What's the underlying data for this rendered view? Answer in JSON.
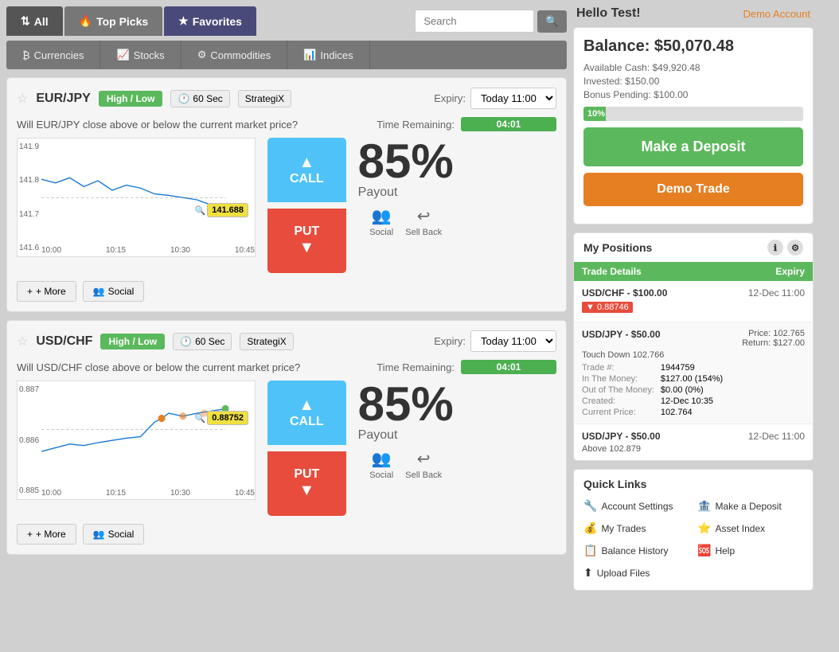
{
  "header": {
    "tabs": [
      {
        "id": "all",
        "label": "All",
        "icon": "⇅",
        "active": true
      },
      {
        "id": "top-picks",
        "label": "Top Picks",
        "icon": "★",
        "active": false
      },
      {
        "id": "favorites",
        "label": "Favorites",
        "icon": "★",
        "active": false
      }
    ],
    "search_placeholder": "Search"
  },
  "subnav": [
    {
      "id": "currencies",
      "label": "Currencies",
      "icon": "₿"
    },
    {
      "id": "stocks",
      "label": "Stocks",
      "icon": "📈"
    },
    {
      "id": "commodities",
      "label": "Commodities",
      "icon": "⚙"
    },
    {
      "id": "indices",
      "label": "Indices",
      "icon": "📊"
    }
  ],
  "trades": [
    {
      "id": "eurjpy",
      "asset": "EUR/JPY",
      "badge": "High / Low",
      "duration": "60 Sec",
      "strategy": "StrategiX",
      "expiry_label": "Expiry:",
      "expiry_value": "Today 11:00",
      "question": "Will EUR/JPY close above or below the current market price?",
      "time_remaining_label": "Time Remaining:",
      "time_remaining_value": "04:01",
      "chart_prices": [
        "141.9",
        "141.8",
        "141.7",
        "141.6"
      ],
      "chart_times": [
        "10:00",
        "10:15",
        "10:30",
        "10:45"
      ],
      "current_price": "141.688",
      "payout": "85%",
      "payout_label": "Payout",
      "call_label": "CALL",
      "put_label": "PUT",
      "social_label": "Social",
      "sellback_label": "Sell Back",
      "more_label": "+ More",
      "social_btn_label": "Social"
    },
    {
      "id": "usdchf",
      "asset": "USD/CHF",
      "badge": "High / Low",
      "duration": "60 Sec",
      "strategy": "StrategiX",
      "expiry_label": "Expiry:",
      "expiry_value": "Today 11:00",
      "question": "Will USD/CHF close above or below the current market price?",
      "time_remaining_label": "Time Remaining:",
      "time_remaining_value": "04:01",
      "chart_prices": [
        "0.887",
        "0.886",
        "0.885"
      ],
      "chart_times": [
        "10:00",
        "10:15",
        "10:30",
        "10:45"
      ],
      "current_price": "0.88752",
      "payout": "85%",
      "payout_label": "Payout",
      "call_label": "CALL",
      "put_label": "PUT",
      "social_label": "Social",
      "sellback_label": "Sell Back",
      "more_label": "+ More",
      "social_btn_label": "Social"
    }
  ],
  "right": {
    "greeting": "Hello Test!",
    "demo_account": "Demo Account",
    "balance_title": "Balance: $50,070.48",
    "available_cash": "Available Cash: $49,920.48",
    "invested": "Invested: $150.00",
    "bonus_pending": "Bonus Pending: $100.00",
    "bonus_percent": "10%",
    "bonus_bar_width": "10",
    "deposit_btn": "Make a Deposit",
    "demo_trade_btn": "Demo Trade",
    "positions_title": "My Positions",
    "positions_col1": "Trade Details",
    "positions_col2": "Expiry",
    "positions": [
      {
        "asset": "USD/CHF - $100.00",
        "expiry": "12-Dec 11:00",
        "tag": "▼",
        "price": "0.88746",
        "detail": null
      },
      {
        "asset": "USD/JPY - $50.00",
        "expiry": "12-Dec 11:00",
        "tag": null,
        "price": null,
        "detail": {
          "touch_down": "Touch Down 102.766",
          "trade_num_label": "Trade #:",
          "trade_num_val": "1944759",
          "itm_label": "In The Money:",
          "itm_val": "$127.00 (154%)",
          "ootm_label": "Out of The Money:",
          "ootm_val": "$0.00 (0%)",
          "created_label": "Created:",
          "created_val": "12-Dec 10:35",
          "cp_label": "Current Price:",
          "cp_val": "102.764",
          "price_label": "Price:",
          "price_val": "102.765",
          "return_label": "Return:",
          "return_val": "$127.00"
        }
      },
      {
        "asset": "USD/JPY - $50.00",
        "expiry": "12-Dec 11:00",
        "tag": null,
        "price": null,
        "detail": {
          "above": "Above 102.879",
          "trade_num_label": null,
          "trade_num_val": null,
          "itm_label": null,
          "itm_val": null,
          "ootm_label": null,
          "ootm_val": null,
          "created_label": null,
          "created_val": null,
          "cp_label": null,
          "cp_val": null,
          "price_label": null,
          "price_val": null,
          "return_label": null,
          "return_val": null
        }
      }
    ],
    "quicklinks_title": "Quick Links",
    "quicklinks": [
      {
        "label": "Account Settings",
        "icon": "🔧",
        "col": 1
      },
      {
        "label": "Make a Deposit",
        "icon": "🏦",
        "col": 2
      },
      {
        "label": "My Trades",
        "icon": "💰",
        "col": 1
      },
      {
        "label": "Asset Index",
        "icon": "⭐",
        "col": 2
      },
      {
        "label": "Balance History",
        "icon": "📋",
        "col": 1
      },
      {
        "label": "Help",
        "icon": "🆘",
        "col": 2
      },
      {
        "label": "Upload Files",
        "icon": "⬆",
        "col": 1
      }
    ]
  }
}
